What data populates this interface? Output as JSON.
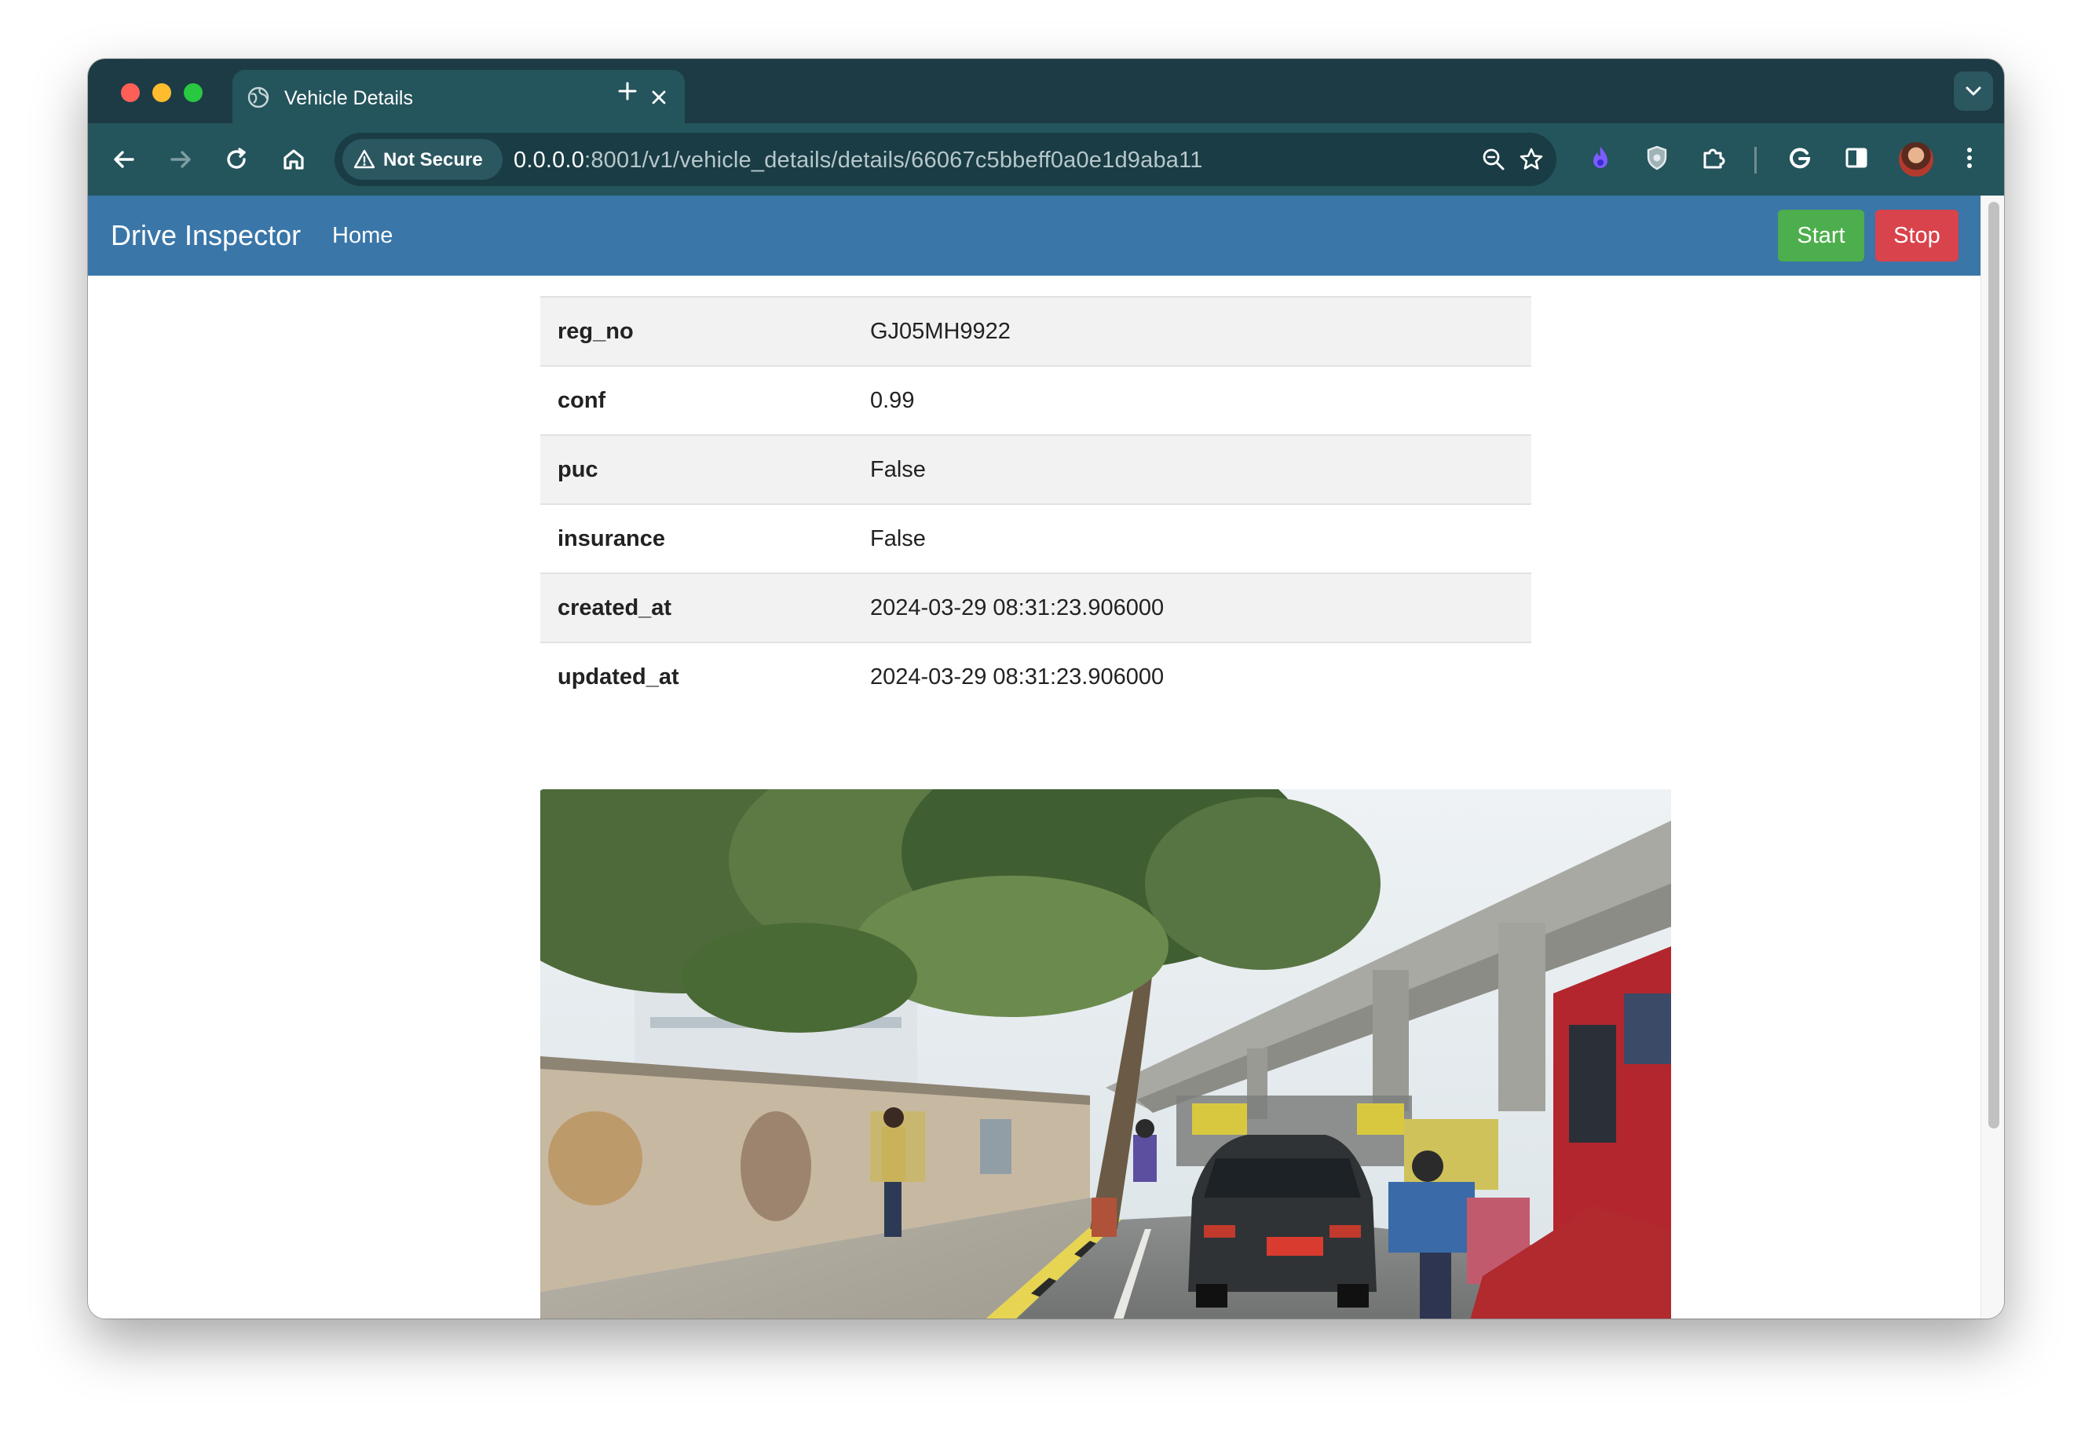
{
  "browser": {
    "tab_title": "Vehicle Details",
    "security_label": "Not Secure",
    "url_host": "0.0.0.0",
    "url_rest": ":8001/v1/vehicle_details/details/66067c5bbeff0a0e1d9aba11"
  },
  "navbar": {
    "brand": "Drive Inspector",
    "home_label": "Home",
    "start_label": "Start",
    "stop_label": "Stop",
    "start_color": "#4cae4c",
    "stop_color": "#d9434b",
    "bar_color": "#3a76a8"
  },
  "details": [
    {
      "key": "reg_no",
      "value": "GJ05MH9922"
    },
    {
      "key": "conf",
      "value": "0.99"
    },
    {
      "key": "puc",
      "value": "False"
    },
    {
      "key": "insurance",
      "value": "False"
    },
    {
      "key": "created_at",
      "value": "2024-03-29 08:31:23.906000"
    },
    {
      "key": "updated_at",
      "value": "2024-03-29 08:31:23.906000"
    }
  ]
}
